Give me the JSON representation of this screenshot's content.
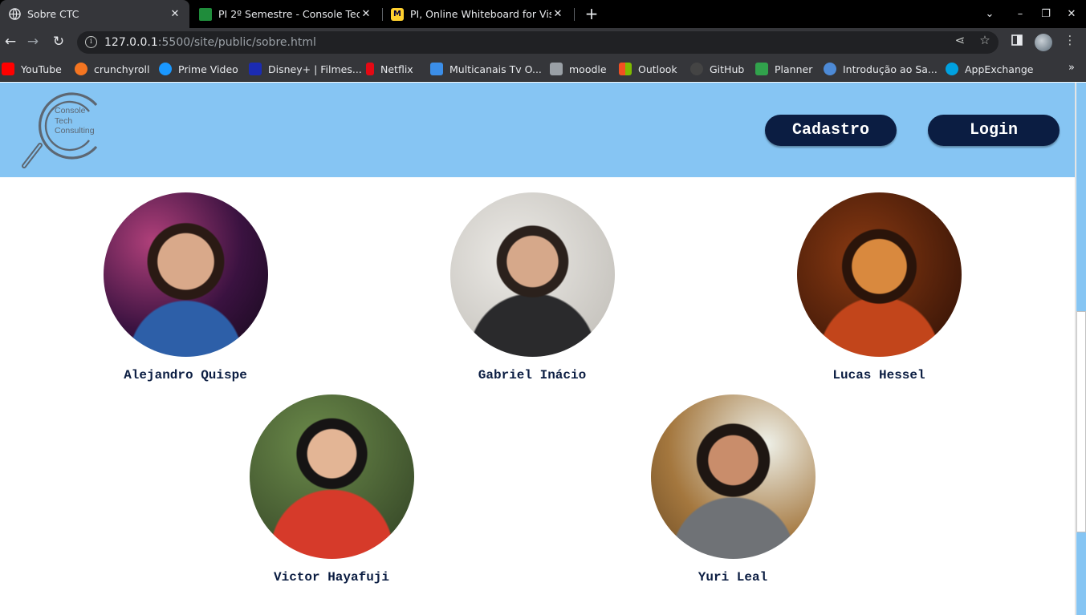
{
  "browser": {
    "tabs": [
      {
        "title": "Sobre CTC",
        "active": true,
        "icon": "globe-icon"
      },
      {
        "title": "PI 2º Semestre - Console Tech",
        "active": false,
        "icon": "planner-icon"
      },
      {
        "title": "PI, Online Whiteboard for Visu",
        "active": false,
        "icon": "miro-icon"
      }
    ],
    "address": {
      "host": "127.0.0.1",
      "path": ":5500/site/public/sobre.html"
    },
    "bookmarks": [
      {
        "label": "YouTube",
        "color": "#ff0000"
      },
      {
        "label": "crunchyroll",
        "color": "#f47521"
      },
      {
        "label": "Prime Video",
        "color": "#1a98ff"
      },
      {
        "label": "Disney+ | Filmes...",
        "color": "#1b2bb3"
      },
      {
        "label": "Netflix",
        "color": "#e50914"
      },
      {
        "label": "Multicanais Tv O...",
        "color": "#3b8ee8"
      },
      {
        "label": "moodle",
        "color": "#9aa0a6"
      },
      {
        "label": "Outlook",
        "color": "#f25022"
      },
      {
        "label": "GitHub",
        "color": "#444444"
      },
      {
        "label": "Planner",
        "color": "#31a24c"
      },
      {
        "label": "Introdução ao Sa...",
        "color": "#4d8ad6"
      },
      {
        "label": "AppExchange",
        "color": "#00a1e0"
      }
    ]
  },
  "site": {
    "logo": {
      "line1": "Console",
      "line2": "Tech",
      "line3": "Consulting"
    },
    "nav": {
      "signup_label": "Cadastro",
      "login_label": "Login"
    },
    "members": [
      {
        "name": "Alejandro Quispe"
      },
      {
        "name": "Gabriel Inácio"
      },
      {
        "name": "Lucas Hessel"
      },
      {
        "name": "Victor Hayafuji"
      },
      {
        "name": "Yuri Leal"
      }
    ]
  },
  "colors": {
    "header_bg": "#86c5f3",
    "accent_dark": "#0b1d42",
    "chrome_bg": "#35363a"
  }
}
